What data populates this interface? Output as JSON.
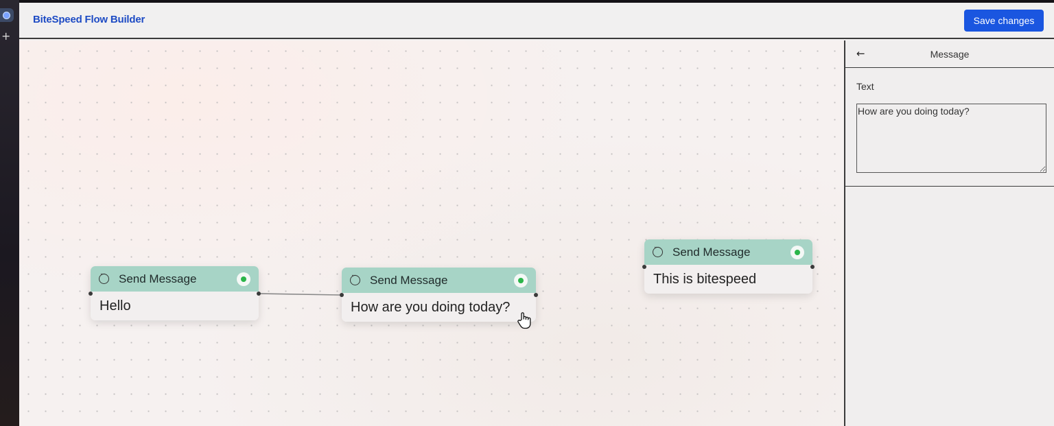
{
  "header": {
    "brand": "BiteSpeed Flow Builder",
    "save_label": "Save changes"
  },
  "os": {
    "plus": "+"
  },
  "nodes": [
    {
      "title": "Send Message",
      "text": "Hello"
    },
    {
      "title": "Send Message",
      "text": "How are you doing today?"
    },
    {
      "title": "Send Message",
      "text": "This is bitespeed"
    }
  ],
  "panel": {
    "back": "←",
    "title": "Message",
    "field_label": "Text",
    "field_value": "How are you doing today?"
  },
  "colors": {
    "accent": "#1a56e0",
    "brand_text": "#1d4bc4",
    "node_header": "#a7d4c6",
    "whatsapp_green": "#2bb54a"
  }
}
